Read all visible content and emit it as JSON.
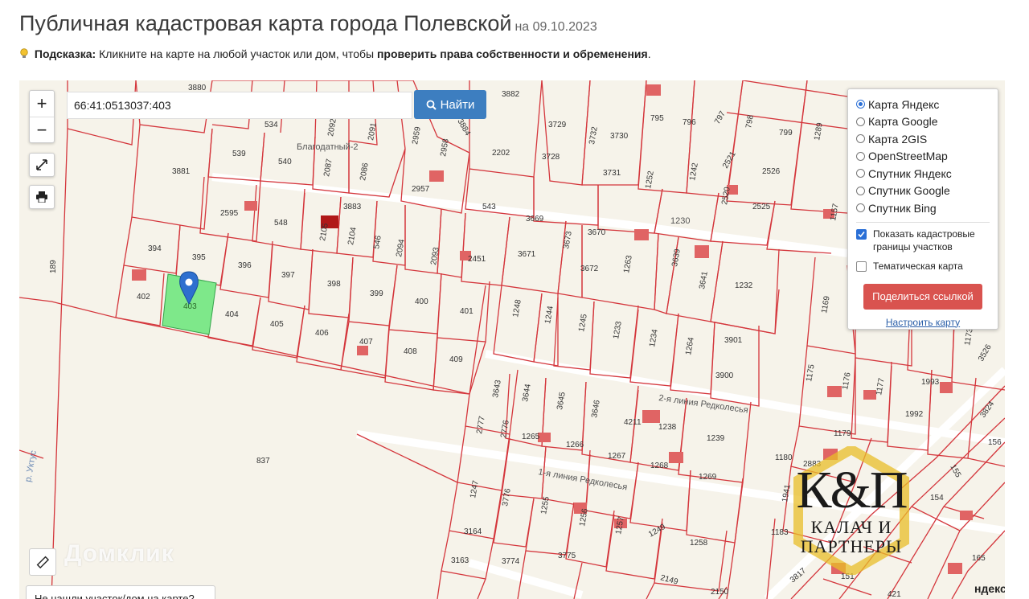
{
  "header": {
    "title": "Публичная кадастровая карта города Полевской",
    "date": "на 09.10.2023"
  },
  "hint": {
    "label": "Подсказка:",
    "text": "Кликните на карте на любой участок или дом, чтобы",
    "emphasis": "проверить права собственности и обременения",
    "end": "."
  },
  "search": {
    "value": "66:41:0513037:403",
    "button_label": "Найти"
  },
  "zoom": {
    "in_label": "+",
    "out_label": "−"
  },
  "layers": {
    "options": [
      {
        "label": "Карта Яндекс",
        "selected": true
      },
      {
        "label": "Карта Google",
        "selected": false
      },
      {
        "label": "Карта 2GIS",
        "selected": false
      },
      {
        "label": "OpenStreetMap",
        "selected": false
      },
      {
        "label": "Спутник Яндекс",
        "selected": false
      },
      {
        "label": "Спутник Google",
        "selected": false
      },
      {
        "label": "Спутник Bing",
        "selected": false
      }
    ],
    "show_borders_label": "Показать кадастровые границы участков",
    "show_borders_checked": true,
    "thematic_label": "Тематическая карта",
    "thematic_checked": false,
    "share_label": "Поделиться ссылкой",
    "config_label": "Настроить карту"
  },
  "map": {
    "streets": [
      "Благодатный-2",
      "1230",
      "2-я линия Редколесья",
      "1-я линия Редколесья",
      "р. Уктус"
    ],
    "parcels": [
      "3880",
      "534",
      "2092",
      "2091",
      "2083",
      "2959",
      "2958",
      "3884",
      "3882",
      "3729",
      "3732",
      "3730",
      "795",
      "796",
      "797",
      "798",
      "799",
      "1289",
      "539",
      "540",
      "2087",
      "2086",
      "2957",
      "2202",
      "3728",
      "3731",
      "1252",
      "1242",
      "2521",
      "2526",
      "3881",
      "2595",
      "548",
      "2105",
      "2104",
      "546",
      "2094",
      "2093",
      "3883",
      "543",
      "3669",
      "3673",
      "3670",
      "2520",
      "2525",
      "1157",
      "394",
      "395",
      "396",
      "397",
      "398",
      "399",
      "400",
      "401",
      "2451",
      "3671",
      "3672",
      "1263",
      "3639",
      "3641",
      "1232",
      "402",
      "403",
      "404",
      "405",
      "406",
      "407",
      "408",
      "409",
      "1248",
      "1244",
      "1245",
      "1233",
      "1234",
      "1264",
      "3901",
      "3900",
      "1169",
      "3643",
      "3644",
      "3645",
      "3646",
      "4211",
      "1238",
      "1239",
      "1175",
      "1176",
      "1177",
      "1993",
      "1992",
      "3824",
      "2777",
      "2776",
      "1265",
      "1266",
      "1267",
      "1268",
      "1269",
      "1179",
      "1180",
      "2883",
      "1247",
      "3776",
      "1255",
      "1256",
      "1257",
      "1249",
      "1258",
      "3164",
      "3163",
      "3774",
      "3775",
      "2149",
      "2150",
      "1183",
      "1941",
      "3817",
      "151",
      "154",
      "155",
      "165",
      "421",
      "837",
      "189",
      "3526",
      "1173",
      "156"
    ]
  },
  "logo": {
    "monogram": "К&П",
    "line1": "КАЛАЧ И",
    "line2": "ПАРТНЕРЫ"
  },
  "watermark": "Домклик",
  "bottom_note": "Не нашли участок/дом на карте?",
  "attribution": "ндекс",
  "colors": {
    "parcel_border": "#d4363c",
    "selected_parcel": "#7ee88a",
    "pin": "#2e6fcf",
    "search_button": "#3d7ec0",
    "share_button": "#d9534f",
    "building": "#e06464"
  }
}
